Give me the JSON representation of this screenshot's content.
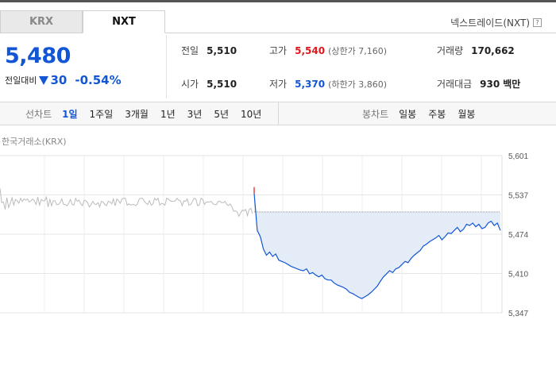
{
  "tabs": [
    {
      "label": "KRX",
      "active": false
    },
    {
      "label": "NXT",
      "active": true
    }
  ],
  "market_name": "넥스트레이드(NXT)",
  "quote": {
    "price": "5,480",
    "change_label": "전일대비",
    "change": "30",
    "change_rate": "-0.54%"
  },
  "stats": {
    "prev_close": {
      "label": "전일",
      "value": "5,510"
    },
    "open": {
      "label": "시가",
      "value": "5,510"
    },
    "high": {
      "label": "고가",
      "value": "5,540",
      "limit": "(상한가 7,160)"
    },
    "low": {
      "label": "저가",
      "value": "5,370",
      "limit": "(하한가 3,860)"
    },
    "volume": {
      "label": "거래량",
      "value": "170,662"
    },
    "amount": {
      "label": "거래대금",
      "value": "930",
      "unit": "백만"
    }
  },
  "line_chart": {
    "title": "선차트",
    "periods": [
      "1일",
      "1주일",
      "3개월",
      "1년",
      "3년",
      "5년",
      "10년"
    ],
    "active": "1일"
  },
  "candle_chart": {
    "title": "봉차트",
    "periods": [
      "일봉",
      "주봉",
      "월봉"
    ]
  },
  "chart_label": "한국거래소(KRX)",
  "colors": {
    "accent": "#1256d6",
    "up": "#e1151a",
    "krx_line": "#bbbbbb",
    "fill": "#e4ecf8"
  },
  "chart_data": {
    "type": "line",
    "ylim": [
      5347,
      5601
    ],
    "yticks": [
      "5,601",
      "5,537",
      "5,474",
      "5,410",
      "5,347"
    ],
    "reference_price": 5510,
    "series": [
      {
        "values": [
          5548,
          5525,
          5526,
          5514,
          5533,
          5517,
          5524,
          5533,
          5521,
          5530,
          5528,
          5524,
          5532,
          5527,
          5531,
          5529,
          5531,
          5526,
          5528,
          5531,
          5528,
          5522,
          5534,
          5521,
          5530,
          5528,
          5528,
          5534,
          5518,
          5531,
          5520,
          5528,
          5528,
          5522,
          5522,
          5525,
          5531,
          5522,
          5522,
          5520,
          5524,
          5530,
          5522,
          5521,
          5532,
          5527,
          5529,
          5523,
          5520,
          5529,
          5528,
          5525,
          5518,
          5522,
          5527,
          5523,
          5522,
          5525,
          5518,
          5527,
          5526,
          5522,
          5520,
          5527,
          5526,
          5523,
          5531,
          5520,
          5531,
          5528,
          5524,
          5531,
          5532,
          5532,
          5521,
          5523,
          5521,
          5522,
          5522,
          5520,
          5523,
          5531,
          5532,
          5532,
          5527,
          5524,
          5522,
          5528,
          5521,
          5523,
          5532,
          5529,
          5532,
          5521,
          5524,
          5523,
          5521,
          5532,
          5531,
          5528,
          5527,
          5527,
          5528,
          5532,
          5529,
          5528,
          5520,
          5528,
          5527,
          5531,
          5521,
          5522,
          5527,
          5532,
          5531,
          5520,
          5521,
          5532,
          5530,
          5522,
          5526,
          5526,
          5526,
          5527,
          5523,
          5522,
          5522,
          5527,
          5527,
          5525,
          5525,
          5527,
          5522,
          5520,
          5523,
          5518,
          5511,
          5512,
          5510,
          5503,
          5508,
          5513,
          5512,
          5514,
          5504,
          5514,
          5516,
          5507
        ]
      },
      {
        "values": [
          5540,
          5480,
          5470,
          5450,
          5440,
          5445,
          5438,
          5442,
          5432,
          5430,
          5428,
          5425,
          5422,
          5420,
          5418,
          5416,
          5415,
          5418,
          5410,
          5412,
          5408,
          5405,
          5408,
          5402,
          5400,
          5400,
          5395,
          5392,
          5390,
          5388,
          5385,
          5380,
          5378,
          5375,
          5372,
          5370,
          5373,
          5376,
          5380,
          5385,
          5390,
          5398,
          5405,
          5410,
          5415,
          5412,
          5418,
          5420,
          5425,
          5430,
          5428,
          5435,
          5440,
          5444,
          5448,
          5455,
          5458,
          5462,
          5465,
          5468,
          5472,
          5465,
          5470,
          5476,
          5475,
          5480,
          5485,
          5478,
          5482,
          5490,
          5488,
          5492,
          5486,
          5490,
          5483,
          5485,
          5492,
          5495,
          5488,
          5492,
          5480
        ]
      }
    ]
  }
}
